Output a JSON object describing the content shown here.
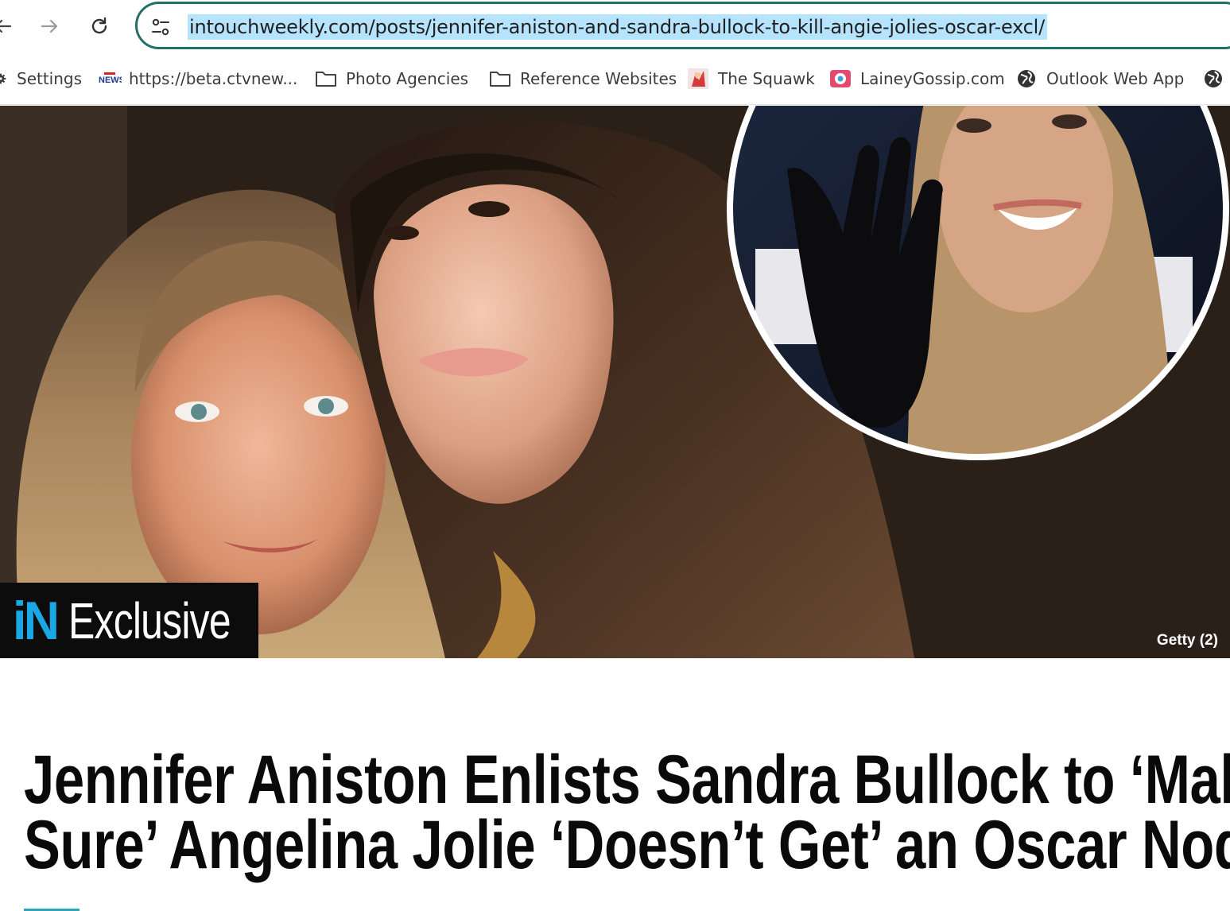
{
  "browser": {
    "url": "intouchweekly.com/posts/jennifer-aniston-and-sandra-bullock-to-kill-angie-jolies-oscar-excl/",
    "accent_color": "#1f6f6b",
    "url_highlight_color": "#b6e3fd"
  },
  "bookmarks": [
    {
      "label": "Settings",
      "icon": "gear-icon"
    },
    {
      "label": "https://beta.ctvnew...",
      "icon": "ctv-news-icon"
    },
    {
      "label": "Photo Agencies",
      "icon": "folder-icon"
    },
    {
      "label": "Reference Websites",
      "icon": "folder-icon"
    },
    {
      "label": "The Squawk",
      "icon": "squawk-favicon"
    },
    {
      "label": "LaineyGossip.com",
      "icon": "lainey-favicon"
    },
    {
      "label": "Outlook Web App",
      "icon": "globe-icon"
    },
    {
      "label": "",
      "icon": "globe-icon"
    }
  ],
  "article": {
    "badge_logo": "iN",
    "badge_text": "Exclusive",
    "photo_credit": "Getty (2)",
    "headline_line1": "Jennifer Aniston Enlists Sandra Bullock to ‘Make",
    "headline_line2": "Sure’ Angelina Jolie ‘Doesn’t Get’ an Oscar Nod",
    "brand_color": "#1aa7e6"
  }
}
